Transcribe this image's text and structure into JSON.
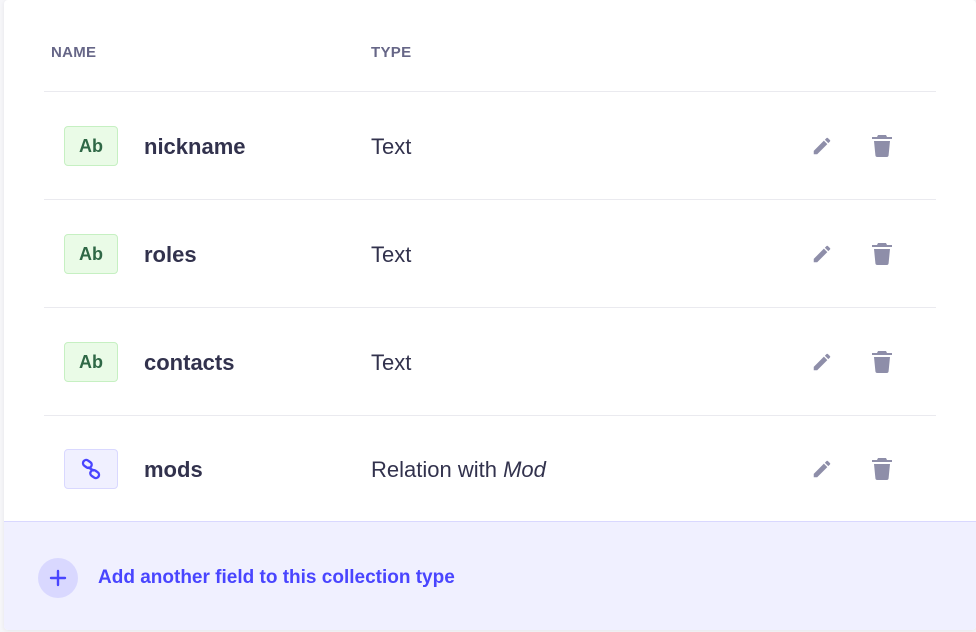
{
  "table": {
    "headers": {
      "name": "NAME",
      "type": "TYPE"
    },
    "rows": [
      {
        "badge": "Ab",
        "badge_kind": "text",
        "name": "nickname",
        "type": "Text",
        "type_target": ""
      },
      {
        "badge": "Ab",
        "badge_kind": "text",
        "name": "roles",
        "type": "Text",
        "type_target": ""
      },
      {
        "badge": "Ab",
        "badge_kind": "text",
        "name": "contacts",
        "type": "Text",
        "type_target": ""
      },
      {
        "badge": "link-icon",
        "badge_kind": "relation",
        "name": "mods",
        "type": "Relation with ",
        "type_target": "Mod"
      }
    ],
    "row_actions": {
      "edit_icon": "pencil-icon",
      "delete_icon": "trash-icon"
    }
  },
  "footer": {
    "add_label": "Add another field to this collection type",
    "add_icon": "plus-icon"
  },
  "colors": {
    "accent": "#4945ff",
    "text_badge_bg": "#eafbe7",
    "text_badge_fg": "#2f6846",
    "icon_gray": "#8e8ea9"
  }
}
